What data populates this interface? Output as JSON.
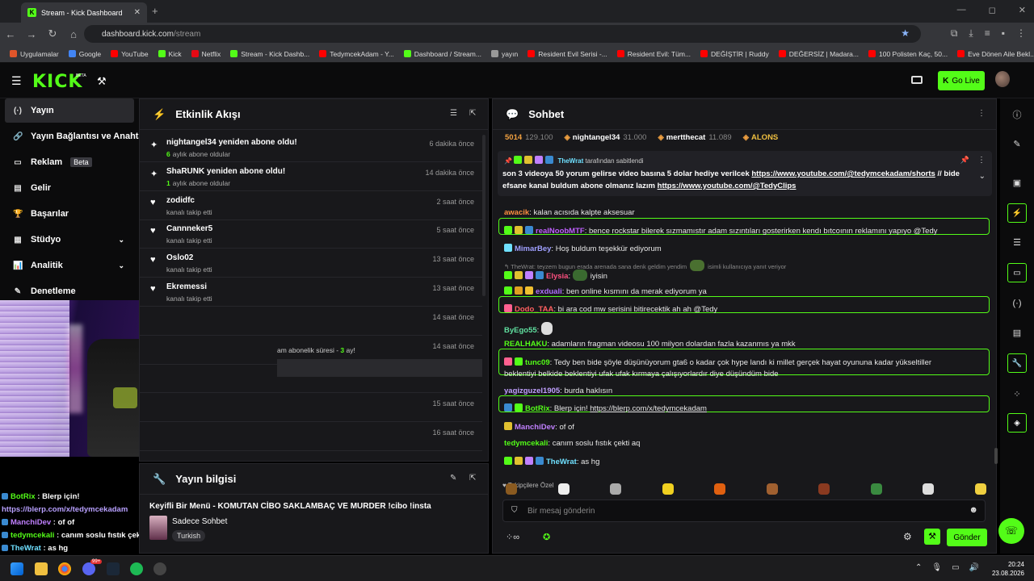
{
  "browser": {
    "tab_title": "Stream - Kick Dashboard",
    "url_host": "dashboard.kick.com",
    "url_path": "/stream",
    "bookmarks": [
      {
        "label": "Uygulamalar",
        "color": "#e0552a"
      },
      {
        "label": "Google",
        "color": "#4285f4"
      },
      {
        "label": "YouTube",
        "color": "#ff0000"
      },
      {
        "label": "Kick",
        "color": "#53fc18"
      },
      {
        "label": "Netflix",
        "color": "#e50914"
      },
      {
        "label": "Stream - Kick Dashb...",
        "color": "#53fc18"
      },
      {
        "label": "TedymcekAdam - Y...",
        "color": "#ff0000"
      },
      {
        "label": "Dashboard / Stream...",
        "color": "#53fc18"
      },
      {
        "label": "yayın",
        "color": "#999999"
      },
      {
        "label": "Resident Evil Serisi -...",
        "color": "#ff0000"
      },
      {
        "label": "Resident Evil: Tüm...",
        "color": "#ff0000"
      },
      {
        "label": "DEĞİŞTİR | Ruddy",
        "color": "#ff0000"
      },
      {
        "label": "DEĞERSİZ | Madara...",
        "color": "#ff0000"
      },
      {
        "label": "100 Polisten Kaç, 50...",
        "color": "#ff0000"
      },
      {
        "label": "Eve Dönen Aile Bekl...",
        "color": "#ff0000"
      }
    ]
  },
  "header": {
    "logo": "KICK",
    "beta": "BETA",
    "go_live": "Go Live"
  },
  "sidebar": {
    "items": [
      {
        "label": "Yayın",
        "icon": "(·)"
      },
      {
        "label": "Yayın Bağlantısı ve Anahtar",
        "icon": "🔗"
      },
      {
        "label": "Reklam",
        "icon": "▭",
        "badge": "Beta"
      },
      {
        "label": "Gelir",
        "icon": "▤"
      },
      {
        "label": "Başarılar",
        "icon": "🏆"
      },
      {
        "label": "Stüdyo",
        "icon": "▦"
      },
      {
        "label": "Analitik",
        "icon": "📊"
      },
      {
        "label": "Denetleme",
        "icon": "✎"
      }
    ]
  },
  "activity": {
    "title": "Etkinlik Akışı",
    "events": [
      {
        "title": "nightangel34 yeniden abone oldu!",
        "count": "6",
        "sub": "aylık abone oldular",
        "time": "6 dakika önce",
        "icon": "✦"
      },
      {
        "title": "ShaRUNK yeniden abone oldu!",
        "count": "1",
        "sub": "aylık abone oldular",
        "time": "14 dakika önce",
        "icon": "✦"
      },
      {
        "title": "zodidfc",
        "count": "",
        "sub": "kanalı takip etti",
        "time": "2 saat önce",
        "icon": "♥"
      },
      {
        "title": "Cannneker5",
        "count": "",
        "sub": "kanalı takip etti",
        "time": "5 saat önce",
        "icon": "♥"
      },
      {
        "title": "Oslo02",
        "count": "",
        "sub": "kanalı takip etti",
        "time": "13 saat önce",
        "icon": "♥"
      },
      {
        "title": "Ekremessi",
        "count": "",
        "sub": "kanalı takip etti",
        "time": "13 saat önce",
        "icon": "♥"
      },
      {
        "title": "",
        "count": "",
        "sub": "",
        "time": "14 saat önce",
        "icon": ""
      },
      {
        "title": "",
        "count": "",
        "sub": "",
        "time": "14 saat önce",
        "icon": ""
      },
      {
        "title": "",
        "count": "",
        "sub": "",
        "time": "14 saat önce",
        "icon": ""
      },
      {
        "title": "",
        "count": "",
        "sub": "",
        "time": "15 saat önce",
        "icon": ""
      },
      {
        "title": "",
        "count": "",
        "sub": "",
        "time": "16 saat önce",
        "icon": ""
      }
    ],
    "partial_sub_prefix": "am abonelik süresi - ",
    "partial_sub_count": "3",
    "partial_sub_suffix": " ay!"
  },
  "stream_info": {
    "title": "Yayın bilgisi",
    "stream_title": "Keyifli Bir Menü - KOMUTAN CİBO SAKLAMBAÇ VE MURDER !cibo !insta",
    "category": "Sadece Sohbet",
    "language": "Turkish"
  },
  "overlay_chat": [
    {
      "user": "BotRix",
      "sep": " : ",
      "text": "Blerp için!",
      "color": "#53fc18"
    },
    {
      "user": "",
      "sep": "",
      "text": "https://blerp.com/x/tedymcekadam",
      "color": "#b8a0ff"
    },
    {
      "user": "ManchiDev",
      "sep": " : ",
      "text": "of of",
      "color": "#c080ff"
    },
    {
      "user": "tedymcekali",
      "sep": " : ",
      "text": "canım soslu fıstık çekti aq",
      "color": "#53fc18"
    },
    {
      "user": "TheWrat",
      "sep": " : ",
      "text": "as hg",
      "color": "#6fe0ff"
    }
  ],
  "chat": {
    "title": "Sohbet",
    "leaders": [
      {
        "name": "5014",
        "points": "129.100",
        "color": "#f0a040"
      },
      {
        "name": "nightangel34",
        "points": "31.000",
        "color": "#ffffff"
      },
      {
        "name": "mertthecat",
        "points": "11.089",
        "color": "#ffffff"
      },
      {
        "name": "ALONS",
        "points": "",
        "color": "#f0c040"
      }
    ],
    "pinned_by_user": "TheWrat",
    "pinned_by_label": " tarafından sabitlendi",
    "pinned_text": "son 3 videoya 50 yorum gelirse video basına 5 dolar hediye verilcek ",
    "pinned_link1": "https://www.youtube.com/@tedymcekadam/shorts",
    "pinned_mid": " // bide efsane kanal buldum abone olmanız lazım ",
    "pinned_link2": "https://www.youtube.com/@TedyClips",
    "messages": [
      {
        "user": "awacik",
        "color": "#ff9040",
        "text": "kalan acısıda kalpte aksesuar"
      },
      {
        "user": "realNoobMTF",
        "color": "#c060ff",
        "text": "bence rockstar bilerek sızmamıstır adam sızıntıları gosterirken kendı bıtcoının reklamını yapıyo @Tedy"
      },
      {
        "user": "MimarBey",
        "color": "#a0a0ff",
        "text": "Hoş buldum teşekkür ediyorum"
      },
      {
        "reply": "TheWrat: teyzem bugun erada arenada sana denk geldim yendim",
        "reply_tail": "isimli kullanıcıya yanıt veriyor"
      },
      {
        "user": "Elysia",
        "color": "#ff5080",
        "text": "iyisin"
      },
      {
        "user": "exduali",
        "color": "#b070ff",
        "text": "ben online kısmını da merak ediyorum ya"
      },
      {
        "user": "Dodo_TAA",
        "color": "#ff6060",
        "text": "bi ara cod mw serisini bitirecektik ah ah @Tedy"
      },
      {
        "user": "ByEgo55",
        "color": "#60e0a0",
        "text": ""
      },
      {
        "user": "REALHAKU",
        "color": "#53fc18",
        "text": "adamların fragman videosu 100 milyon dolardan fazla kazanmıs ya mkk"
      },
      {
        "user": "tunc09",
        "color": "#53fc18",
        "text": "Tedy ben bide şöyle düşünüyorum gta6 o kadar çok hype landı ki millet gerçek hayat oyununa kadar yükseltiller"
      },
      {
        "user": "",
        "color": "#ffffff",
        "text": "beklentiyi belkide beklentiyi ufak ufak kırmaya çalışıyorlardır diye düşündüm bide"
      },
      {
        "user": "yagizguzel1905",
        "color": "#c0a0ff",
        "text": "burda haklısın"
      },
      {
        "user": "BotRix",
        "color": "#53fc18",
        "text": "Blerp için! ",
        "link": "https://blerp.com/x/tedymcekadam"
      },
      {
        "user": "ManchiDev",
        "color": "#c080ff",
        "text": "of of"
      },
      {
        "user": "tedymcekali",
        "color": "#53fc18",
        "text": "canım soslu fıstık çekti aq"
      },
      {
        "user": "TheWrat",
        "color": "#6fe0ff",
        "text": "as hg"
      }
    ],
    "emote_label": "Takipçilere Özel",
    "input_placeholder": "Bir mesaj gönderin",
    "send_label": "Gönder"
  },
  "taskbar": {
    "time": "20:24",
    "date": "23.08.2026",
    "discord_badge": "99+"
  },
  "colors": {
    "accent": "#53fc18",
    "panel": "#18181b",
    "bg": "#0b0b0c"
  }
}
